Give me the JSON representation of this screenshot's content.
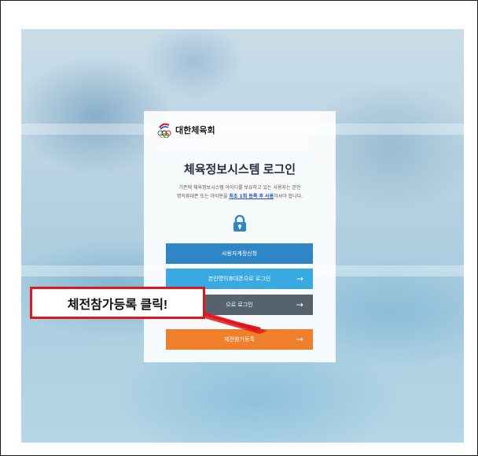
{
  "brand": {
    "name": "대한체육회",
    "logo_icon": "olympic-rings-logo-icon"
  },
  "login": {
    "title": "체육정보시스템 로그인",
    "desc_line1": "기존에 체육정보시스템 아이디를 보유하고 있는 사용자는 본인",
    "desc_line2_pre": "명의휴대폰 또는 아이핀을 ",
    "desc_line2_hl": "최초 1회 등록 후 사용",
    "desc_line2_post": "하셔야 합니다.",
    "lock_icon": "lock-icon"
  },
  "buttons": {
    "account_request": "사용자계정신청",
    "phone_login": "본인명의휴대폰으로 로그인",
    "ipin_login": "으로 로그인",
    "event_register": "체전참가등록",
    "arrow": "→"
  },
  "annotation": {
    "callout_text": "체전참가등록 클릭!"
  },
  "colors": {
    "btn_blue": "#2f86c6",
    "btn_lightblue": "#39a9e2",
    "btn_gray": "#56636d",
    "btn_orange": "#ef7f2a",
    "callout_red": "#e0161d",
    "highlight_link": "#2a4ccf"
  }
}
